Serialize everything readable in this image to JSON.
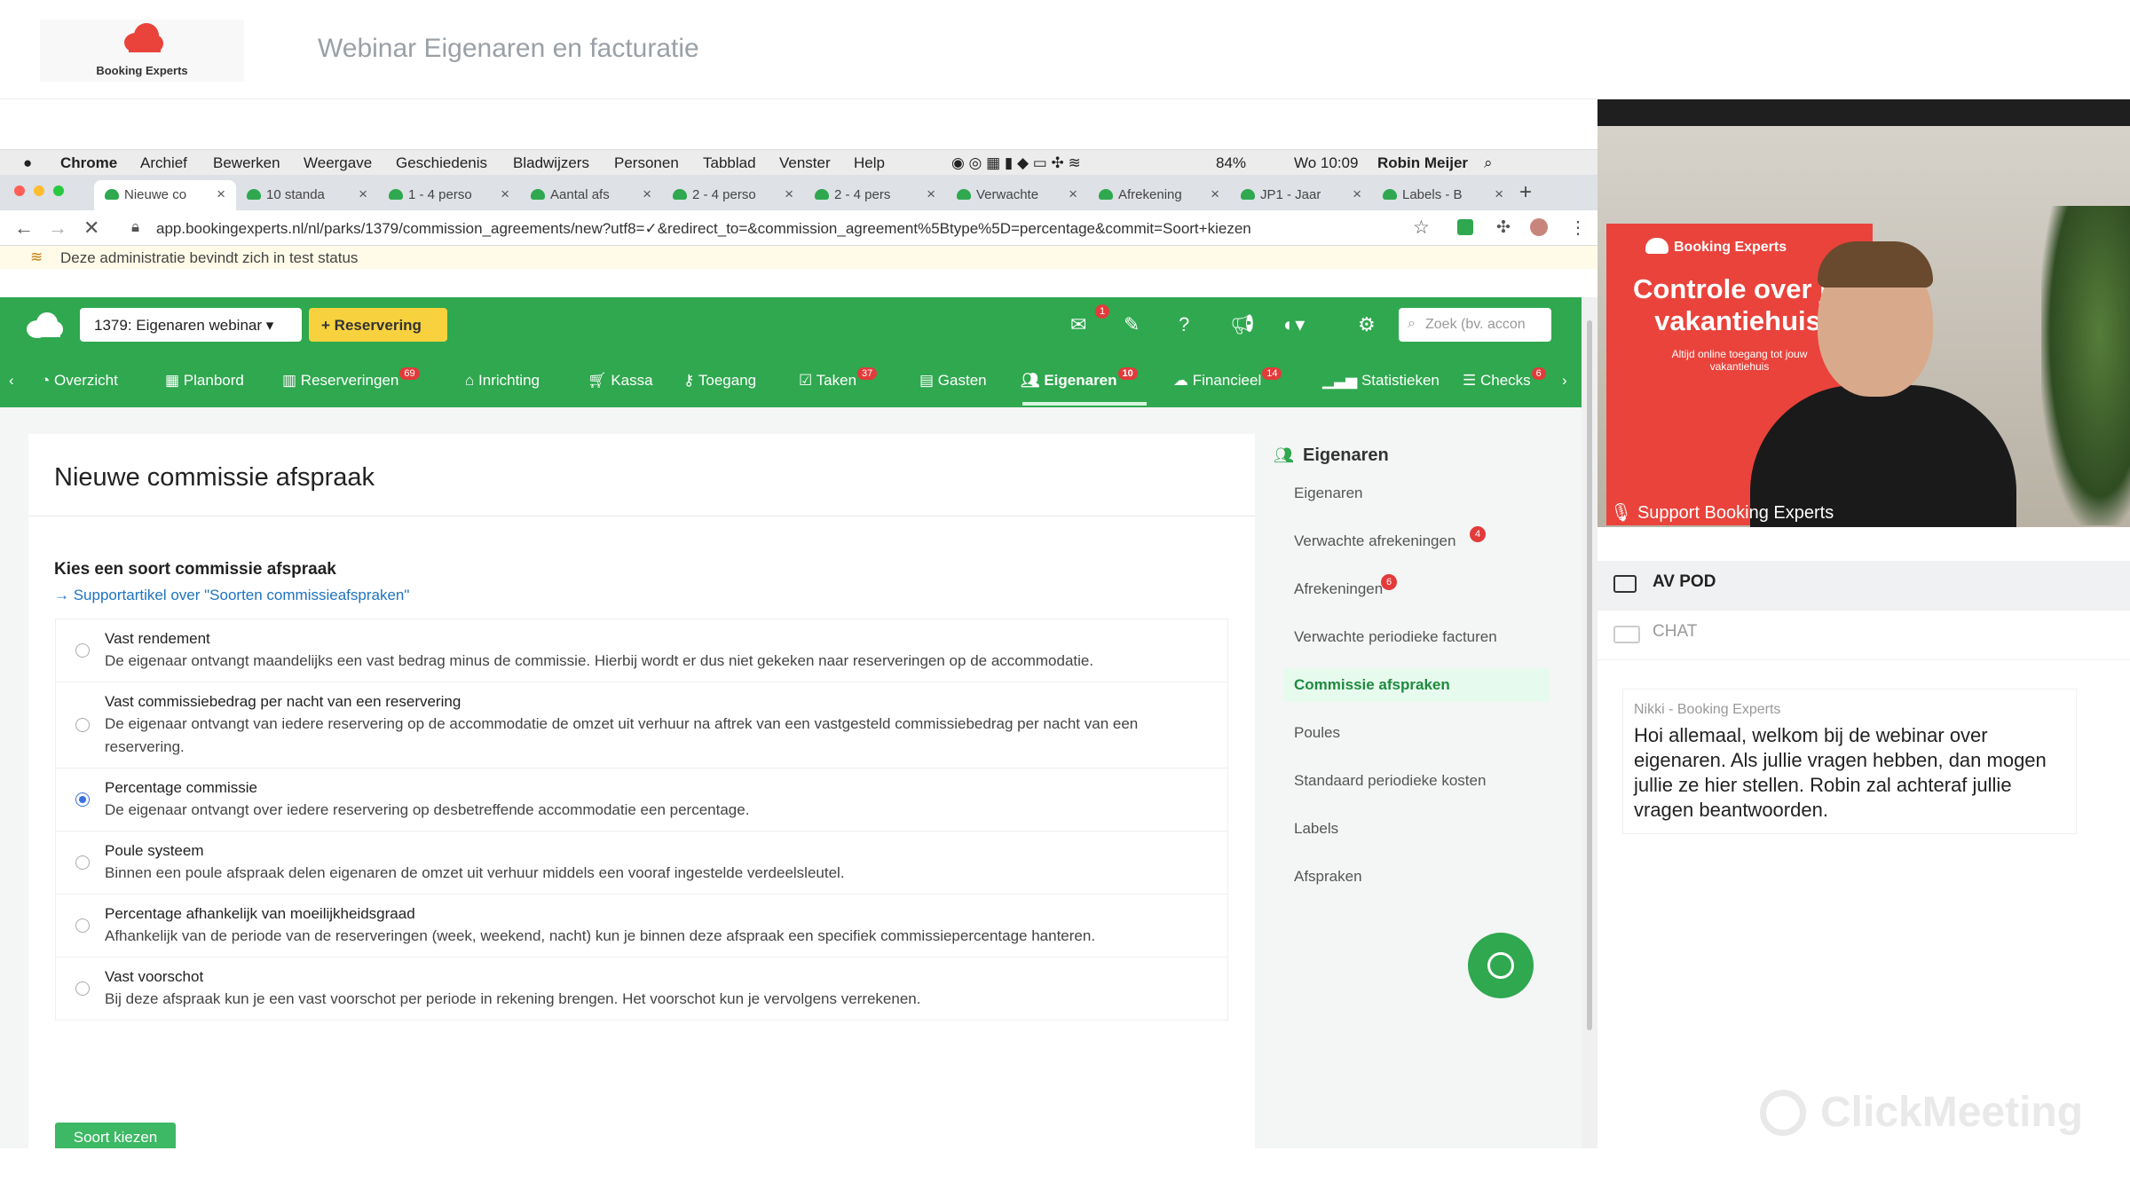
{
  "webinar": {
    "logo_text": "Booking Experts",
    "title": "Webinar Eigenaren en facturatie"
  },
  "mac_menubar": {
    "items": [
      "Chrome",
      "Archief",
      "Bewerken",
      "Weergave",
      "Geschiedenis",
      "Bladwijzers",
      "Personen",
      "Tabblad",
      "Venster",
      "Help"
    ],
    "battery": "84%",
    "clock": "Wo 10:09",
    "user": "Robin Meijer"
  },
  "browser": {
    "tabs": [
      "Nieuwe co",
      "10 standa",
      "1 - 4 perso",
      "Aantal afs",
      "2 - 4 perso",
      "2 - 4 pers",
      "Verwachte",
      "Afrekening",
      "JP1 - Jaar",
      "Labels - B"
    ],
    "url": "app.bookingexperts.nl/nl/parks/1379/commission_agreements/new?utf8=✓&redirect_to=&commission_agreement%5Btype%5D=percentage&commit=Soort+kiezen",
    "test_banner": "Deze administratie bevindt zich in test status"
  },
  "app": {
    "park_select": "1379: Eigenaren webinar",
    "new_booking": "Reservering",
    "search_placeholder": "Zoek (bv. accon",
    "nav": [
      {
        "label": "Overzicht",
        "badge": ""
      },
      {
        "label": "Planbord",
        "badge": ""
      },
      {
        "label": "Reserveringen",
        "badge": "69"
      },
      {
        "label": "Inrichting",
        "badge": ""
      },
      {
        "label": "Kassa",
        "badge": ""
      },
      {
        "label": "Toegang",
        "badge": ""
      },
      {
        "label": "Taken",
        "badge": "37"
      },
      {
        "label": "Gasten",
        "badge": ""
      },
      {
        "label": "Eigenaren",
        "badge": "10"
      },
      {
        "label": "Financieel",
        "badge": "14"
      },
      {
        "label": "Statistieken",
        "badge": ""
      },
      {
        "label": "Checks",
        "badge": "6"
      }
    ],
    "mail_badge": "1"
  },
  "page": {
    "title": "Nieuwe commissie afspraak",
    "section_title": "Kies een soort commissie afspraak",
    "support_link": "→ Supportartikel over \"Soorten commissieafspraken\"",
    "options": [
      {
        "title": "Vast rendement",
        "desc": "De eigenaar ontvangt maandelijks een vast bedrag minus de commissie. Hierbij wordt er dus niet gekeken naar reserveringen op de accommodatie.",
        "checked": false
      },
      {
        "title": "Vast commissiebedrag per nacht van een reservering",
        "desc": "De eigenaar ontvangt van iedere reservering op de accommodatie de omzet uit verhuur na aftrek van een vastgesteld commissiebedrag per nacht van een reservering.",
        "checked": false
      },
      {
        "title": "Percentage commissie",
        "desc": "De eigenaar ontvangt over iedere reservering op desbetreffende accommodatie een percentage.",
        "checked": true
      },
      {
        "title": "Poule systeem",
        "desc": "Binnen een poule afspraak delen eigenaren de omzet uit verhuur middels een vooraf ingestelde verdeelsleutel.",
        "checked": false
      },
      {
        "title": "Percentage afhankelijk van moeilijkheidsgraad",
        "desc": "Afhankelijk van de periode van de reserveringen (week, weekend, nacht) kun je binnen deze afspraak een specifiek commissiepercentage hanteren.",
        "checked": false
      },
      {
        "title": "Vast voorschot",
        "desc": "Bij deze afspraak kun je een vast voorschot per periode in rekening brengen. Het voorschot kun je vervolgens verrekenen.",
        "checked": false
      }
    ],
    "submit": "Soort kiezen"
  },
  "sidebar": {
    "title": "Eigenaren",
    "items": [
      {
        "label": "Eigenaren",
        "badge": "",
        "active": false
      },
      {
        "label": "Verwachte afrekeningen",
        "badge": "4",
        "active": false
      },
      {
        "label": "Afrekeningen",
        "badge": "6",
        "active": false
      },
      {
        "label": "Verwachte periodieke facturen",
        "badge": "",
        "active": false
      },
      {
        "label": "Commissie afspraken",
        "badge": "",
        "active": true
      },
      {
        "label": "Poules",
        "badge": "",
        "active": false
      },
      {
        "label": "Standaard periodieke kosten",
        "badge": "",
        "active": false
      },
      {
        "label": "Labels",
        "badge": "",
        "active": false
      },
      {
        "label": "Afspraken",
        "badge": "",
        "active": false
      }
    ]
  },
  "video": {
    "banner_brand": "Booking Experts",
    "banner_headline": "Controle over je vakantiehuis",
    "banner_sub": "Altijd online toegang tot jouw vakantiehuis",
    "label": "Support Booking Experts"
  },
  "panels": {
    "av_pod": "AV POD",
    "chat": "CHAT"
  },
  "chat": {
    "author": "Nikki - Booking Experts",
    "message": "Hoi allemaal, welkom bij de webinar over eigenaren. Als jullie vragen hebben, dan mogen jullie ze hier stellen. Robin zal achteraf jullie vragen beantwoorden."
  },
  "watermark": "ClickMeeting",
  "colors": {
    "brand_green": "#2fa84f",
    "badge_red": "#e23b3b",
    "booking_button": "#f7d23e",
    "link_blue": "#1e73be"
  }
}
